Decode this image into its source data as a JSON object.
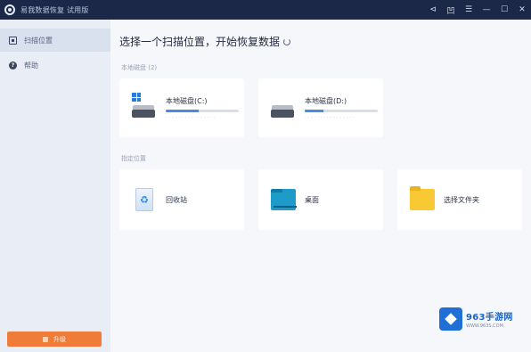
{
  "titlebar": {
    "title": "易我数据恢复 试用版",
    "controls": [
      {
        "name": "share-icon",
        "glyph": "⊲"
      },
      {
        "name": "pin-icon",
        "glyph": "凹"
      },
      {
        "name": "menu-icon",
        "glyph": "☰"
      },
      {
        "name": "minimize-icon",
        "glyph": "—"
      },
      {
        "name": "maximize-icon",
        "glyph": "☐"
      },
      {
        "name": "close-icon",
        "glyph": "✕"
      }
    ]
  },
  "sidebar": {
    "items": [
      {
        "label": "扫描位置",
        "icon": "scan-icon"
      },
      {
        "label": "帮助",
        "icon": "help-icon"
      }
    ],
    "upgrade_label": "升级"
  },
  "main": {
    "heading": "选择一个扫描位置，开始恢复数据",
    "drives_section": "本地磁盘 (2)",
    "drives": [
      {
        "name": "本地磁盘(C:)",
        "size": "· · · · · · · · · · · · · · · ·",
        "used_fraction": 0.45
      },
      {
        "name": "本地磁盘(D:)",
        "size": "· · · · · · · · · · · · · · · ·",
        "used_fraction": 0.25
      }
    ],
    "locations_section": "指定位置",
    "locations": [
      {
        "name": "回收站",
        "icon": "recycle-bin-icon"
      },
      {
        "name": "桌面",
        "icon": "desktop-icon"
      },
      {
        "name": "选择文件夹",
        "icon": "folder-icon"
      }
    ]
  },
  "watermark": {
    "main": "963手游网",
    "sub": "WWW.963S.COM"
  },
  "colors": {
    "titlebar_bg": "#1b2848",
    "sidebar_bg": "#e9edf5",
    "accent_orange": "#f07c3a",
    "accent_blue": "#4a8ae0"
  }
}
